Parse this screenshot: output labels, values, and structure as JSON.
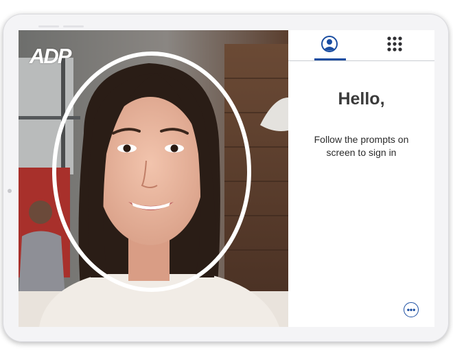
{
  "logo": {
    "text": "ADP"
  },
  "tabs": [
    {
      "icon": "person-icon",
      "active": true
    },
    {
      "icon": "keypad-icon",
      "active": false
    }
  ],
  "panel": {
    "greeting": "Hello,",
    "prompt": "Follow the prompts on screen to sign in"
  },
  "more_button": {
    "label": "•••",
    "icon": "more-options-icon"
  },
  "colors": {
    "accent": "#1a4da1",
    "oval": "#ffffff",
    "heading": "#3a3a3a"
  }
}
